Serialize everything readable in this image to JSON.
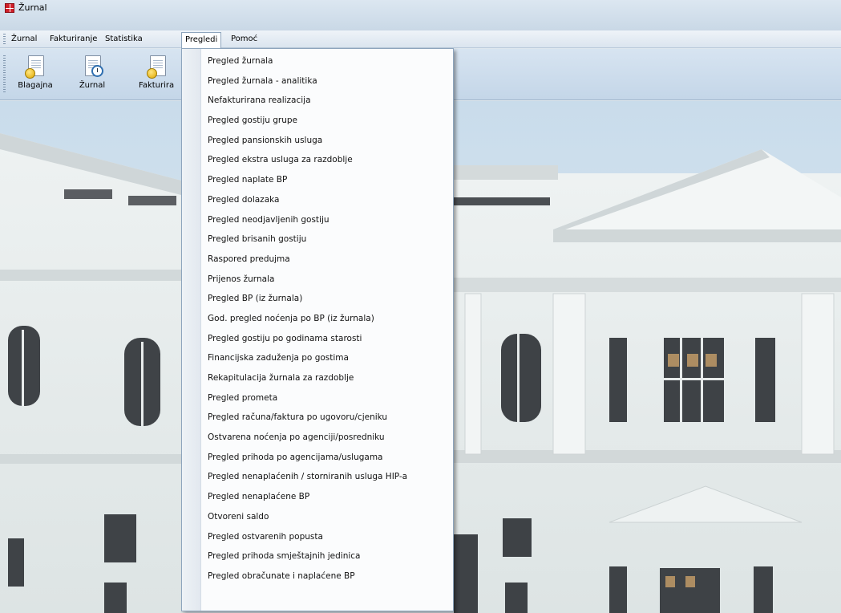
{
  "window": {
    "title": "Žurnal"
  },
  "menubar": {
    "items": [
      {
        "label": "Žurnal"
      },
      {
        "label": "Fakturiranje"
      },
      {
        "label": "Statistika"
      },
      {
        "label": "Pregledi"
      },
      {
        "label": "Pomoć"
      }
    ],
    "active_index": 3
  },
  "toolbar": {
    "buttons": [
      {
        "label": "Blagajna",
        "icon": "cash-register-icon"
      },
      {
        "label": "Žurnal",
        "icon": "journal-clock-icon"
      },
      {
        "label": "Fakturira",
        "icon": "invoice-icon"
      }
    ]
  },
  "dropdown": {
    "items": [
      "Pregled žurnala",
      "Pregled žurnala - analitika",
      "Nefakturirana realizacija",
      "Pregled gostiju grupe",
      "Pregled pansionskih usluga",
      "Pregled ekstra usluga za razdoblje",
      "Pregled naplate BP",
      "Pregled dolazaka",
      "Pregled neodjavljenih gostiju",
      "Pregled brisanih gostiju",
      "Raspored predujma",
      "Prijenos žurnala",
      "Pregled BP (iz žurnala)",
      "God. pregled noćenja po BP (iz žurnala)",
      "Pregled gostiju po godinama starosti",
      "Financijska zaduženja po gostima",
      "Rekapitulacija žurnala za razdoblje",
      "Pregled prometa",
      "Pregled računa/faktura po ugovoru/cjeniku",
      "Ostvarena noćenja po agenciji/posredniku",
      "Pregled prihoda po agencijama/uslugama",
      "Pregled nenaplaćenih / storniranih usluga HIP-a",
      "Pregled nenaplaćene BP",
      "Otvoreni saldo",
      "Pregled ostvarenih popusta",
      "Pregled prihoda smještajnih jedinica",
      "Pregled obračunate i naplaćene BP"
    ]
  },
  "colors": {
    "menu_border": "#8ea5bd",
    "toolbar_bg": "#c4d6e8",
    "building": "#e9eeee"
  }
}
